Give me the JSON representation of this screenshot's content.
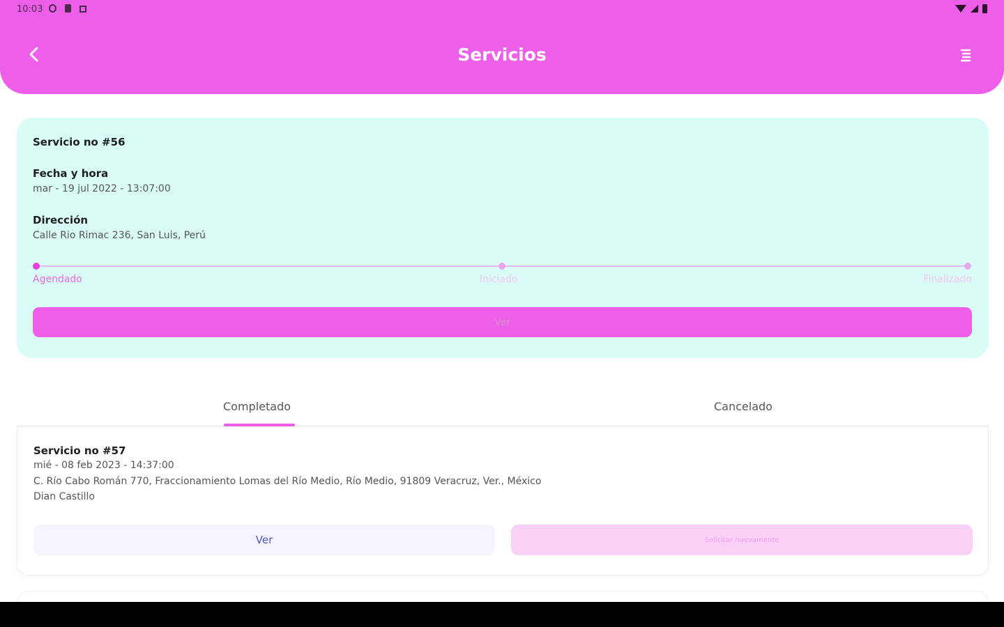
{
  "status_bar": {
    "time": "10:03"
  },
  "header": {
    "title": "Servicios"
  },
  "active_service": {
    "number": "Servicio no #56",
    "date_label": "Fecha y hora",
    "date_value": "mar - 19 jul 2022 - 13:07:00",
    "address_label": "Dirección",
    "address_value": "Calle Rio Rimac 236, San Luis, Perú",
    "progress_steps": [
      "Agendado",
      "Iniciado",
      "Finalizado"
    ],
    "current_step": 0,
    "ver_label": "Ver"
  },
  "tabs": [
    {
      "label": "Completado",
      "active": true
    },
    {
      "label": "Cancelado",
      "active": false
    }
  ],
  "history": [
    {
      "number": "Servicio no #57",
      "date": "mié - 08 feb 2023 - 14:37:00",
      "address": "C. Río Cabo Román 770, Fraccionamiento Lomas del Río Medio, Río Medio, 91809 Veracruz, Ver., México",
      "provider": "Dian  Castillo",
      "ver_label": "Ver",
      "again_label": "Solicitar nuevamente"
    }
  ],
  "colors": {
    "header": "#ee5fe9",
    "active_card_bg": "#d9fdf6",
    "accent": "#ee5fe9",
    "ver_secondary_bg": "#f5f4ff",
    "again_bg": "#fbd0f8"
  }
}
